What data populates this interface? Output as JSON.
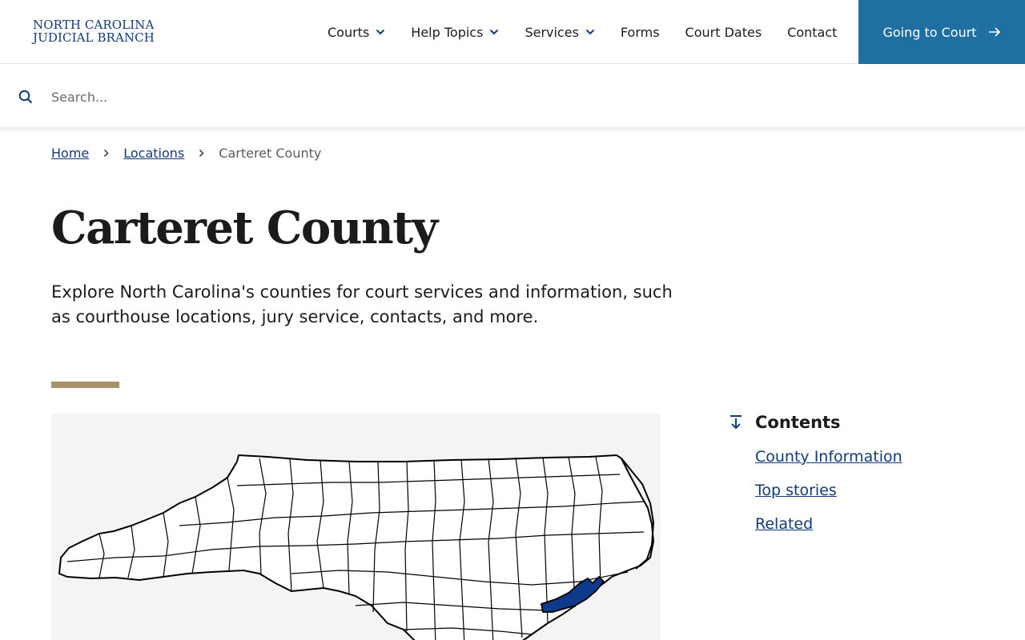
{
  "header": {
    "logo_line1": "NORTH CAROLINA",
    "logo_line2": "JUDICIAL BRANCH",
    "nav": [
      {
        "label": "Courts",
        "dropdown": true
      },
      {
        "label": "Help Topics",
        "dropdown": true
      },
      {
        "label": "Services",
        "dropdown": true
      },
      {
        "label": "Forms",
        "dropdown": false
      },
      {
        "label": "Court Dates",
        "dropdown": false
      },
      {
        "label": "Contact",
        "dropdown": false
      }
    ],
    "cta_label": "Going to Court"
  },
  "search": {
    "placeholder": "Search...",
    "value": ""
  },
  "breadcrumb": {
    "items": [
      "Home",
      "Locations"
    ],
    "current": "Carteret County"
  },
  "page": {
    "title": "Carteret County",
    "intro": "Explore North Carolina's counties for court services and information, such as courthouse locations, jury service, contacts, and more."
  },
  "map": {
    "highlighted_county": "Carteret County",
    "highlight_color": "#0d3a8a",
    "background_color": "#f4f4f4"
  },
  "contents": {
    "title": "Contents",
    "links": [
      "County Information",
      "Top stories",
      "Related"
    ]
  },
  "colors": {
    "brand_blue": "#123a7a",
    "cta_blue": "#1f6fa3",
    "accent_gold": "#a8936b"
  }
}
